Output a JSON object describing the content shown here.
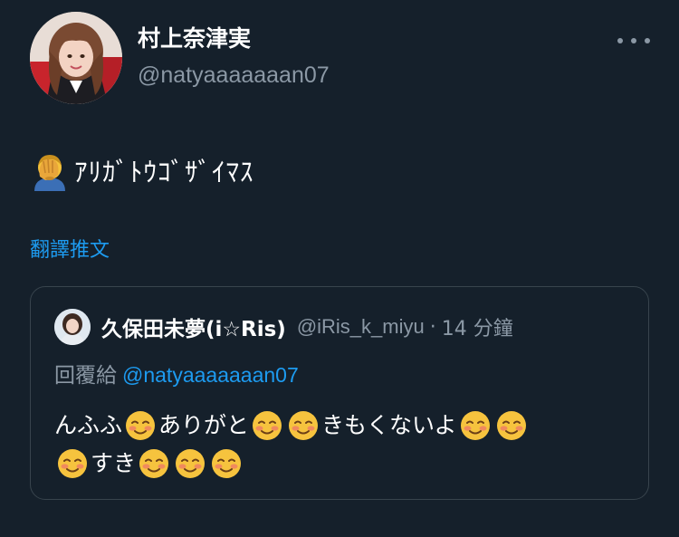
{
  "tweet": {
    "author": {
      "display_name": "村上奈津実",
      "handle": "@natyaaaaaaan07"
    },
    "more_icon": "ellipsis-icon",
    "text_emoji": "facepalm-emoji",
    "text": "ｱﾘｶﾞﾄｳｺﾞｻﾞｲﾏｽ",
    "translate_label": "翻譯推文"
  },
  "quote": {
    "author": {
      "display_name": "久保田未夢(i☆Ris)",
      "handle": "@iRis_k_miyu",
      "separator": "·",
      "time": "14 分鐘"
    },
    "reply_label": "回覆給",
    "reply_mention": "@natyaaaaaaan07",
    "lines": [
      {
        "segments": [
          "んふふ",
          "☺",
          "ありがと",
          "☺",
          "☺",
          "きもくないよ",
          "☺",
          "☺"
        ]
      },
      {
        "segments": [
          "☺",
          "すき",
          "☺",
          "☺",
          "☺"
        ]
      }
    ],
    "emoji_name": "smiling-face-emoji"
  },
  "colors": {
    "background": "#15202b",
    "text_primary": "#ffffff",
    "text_secondary": "#8b98a5",
    "accent": "#1d9bf0",
    "border": "#38444d"
  }
}
